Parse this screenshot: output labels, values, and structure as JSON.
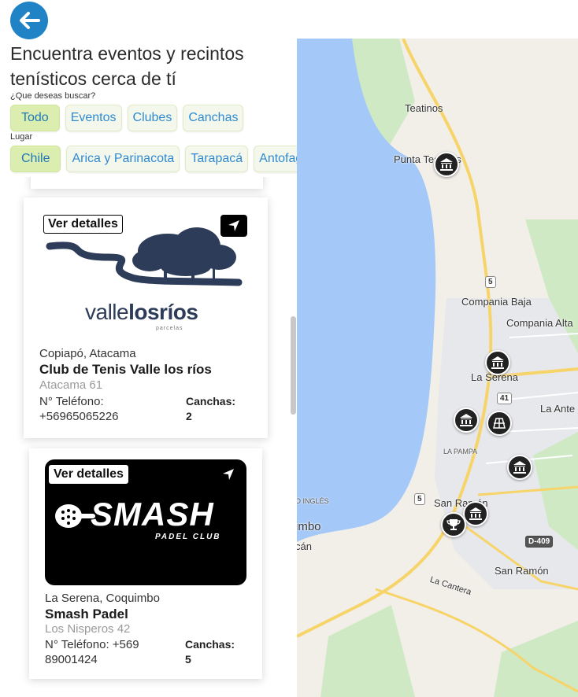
{
  "header": {
    "title": "Encuentra eventos y recintos tenísticos cerca de tí"
  },
  "search": {
    "label": "¿Que deseas buscar?",
    "options": [
      "Todo",
      "Eventos",
      "Clubes",
      "Canchas"
    ]
  },
  "place": {
    "label": "Lugar",
    "options": [
      "Chile",
      "Arica y Parinacota",
      "Tarapacá",
      "Antofagasta"
    ]
  },
  "clubs": [
    {
      "details_label": "Ver detalles",
      "logo_main": "valle",
      "logo_bold": "losríos",
      "logo_sub": "parcelas",
      "city": "Copiapó, Atacama",
      "name": "Club de Tenis Valle los ríos",
      "address": "Atacama 61",
      "phone_label": "N° Teléfono:",
      "phone": "+56965065226",
      "courts_label": "Canchas:",
      "courts": "2"
    },
    {
      "details_label": "Ver detalles",
      "logo_main": "SMASH",
      "logo_sub": "PADEL CLUB",
      "city": "La Serena, Coquimbo",
      "name": "Smash Padel",
      "address": "Los Nisperos 42",
      "phone_line1": "N° Teléfono: +569",
      "phone_line2": "89001424",
      "courts_label": "Canchas:",
      "courts": "5"
    }
  ],
  "map": {
    "labels": {
      "teatinos": "Teatinos",
      "punta_teatinos": "Punta Teatinos",
      "compania_baja": "Compania Baja",
      "compania_alta": "Compania Alta",
      "la_serena": "La Serena",
      "la_antena": "La Ante",
      "la_pampa": "LA PAMPA",
      "ingles": "O INGLÉS",
      "san_ramon_1": "San Ramón",
      "san_ramon_2": "San Ramón",
      "coquimbo_partial": "imbo",
      "can_partial": "cán",
      "la_cantera": "La Cantera"
    },
    "shields": {
      "r5a": "5",
      "r41": "41",
      "r5b": "5",
      "d409": "D-409"
    },
    "colors": {
      "water": "#a4c8f7",
      "land": "#f2efe9",
      "urban": "#e7e8ec",
      "green": "#cfe9c5",
      "highway": "#f7d46a"
    }
  }
}
